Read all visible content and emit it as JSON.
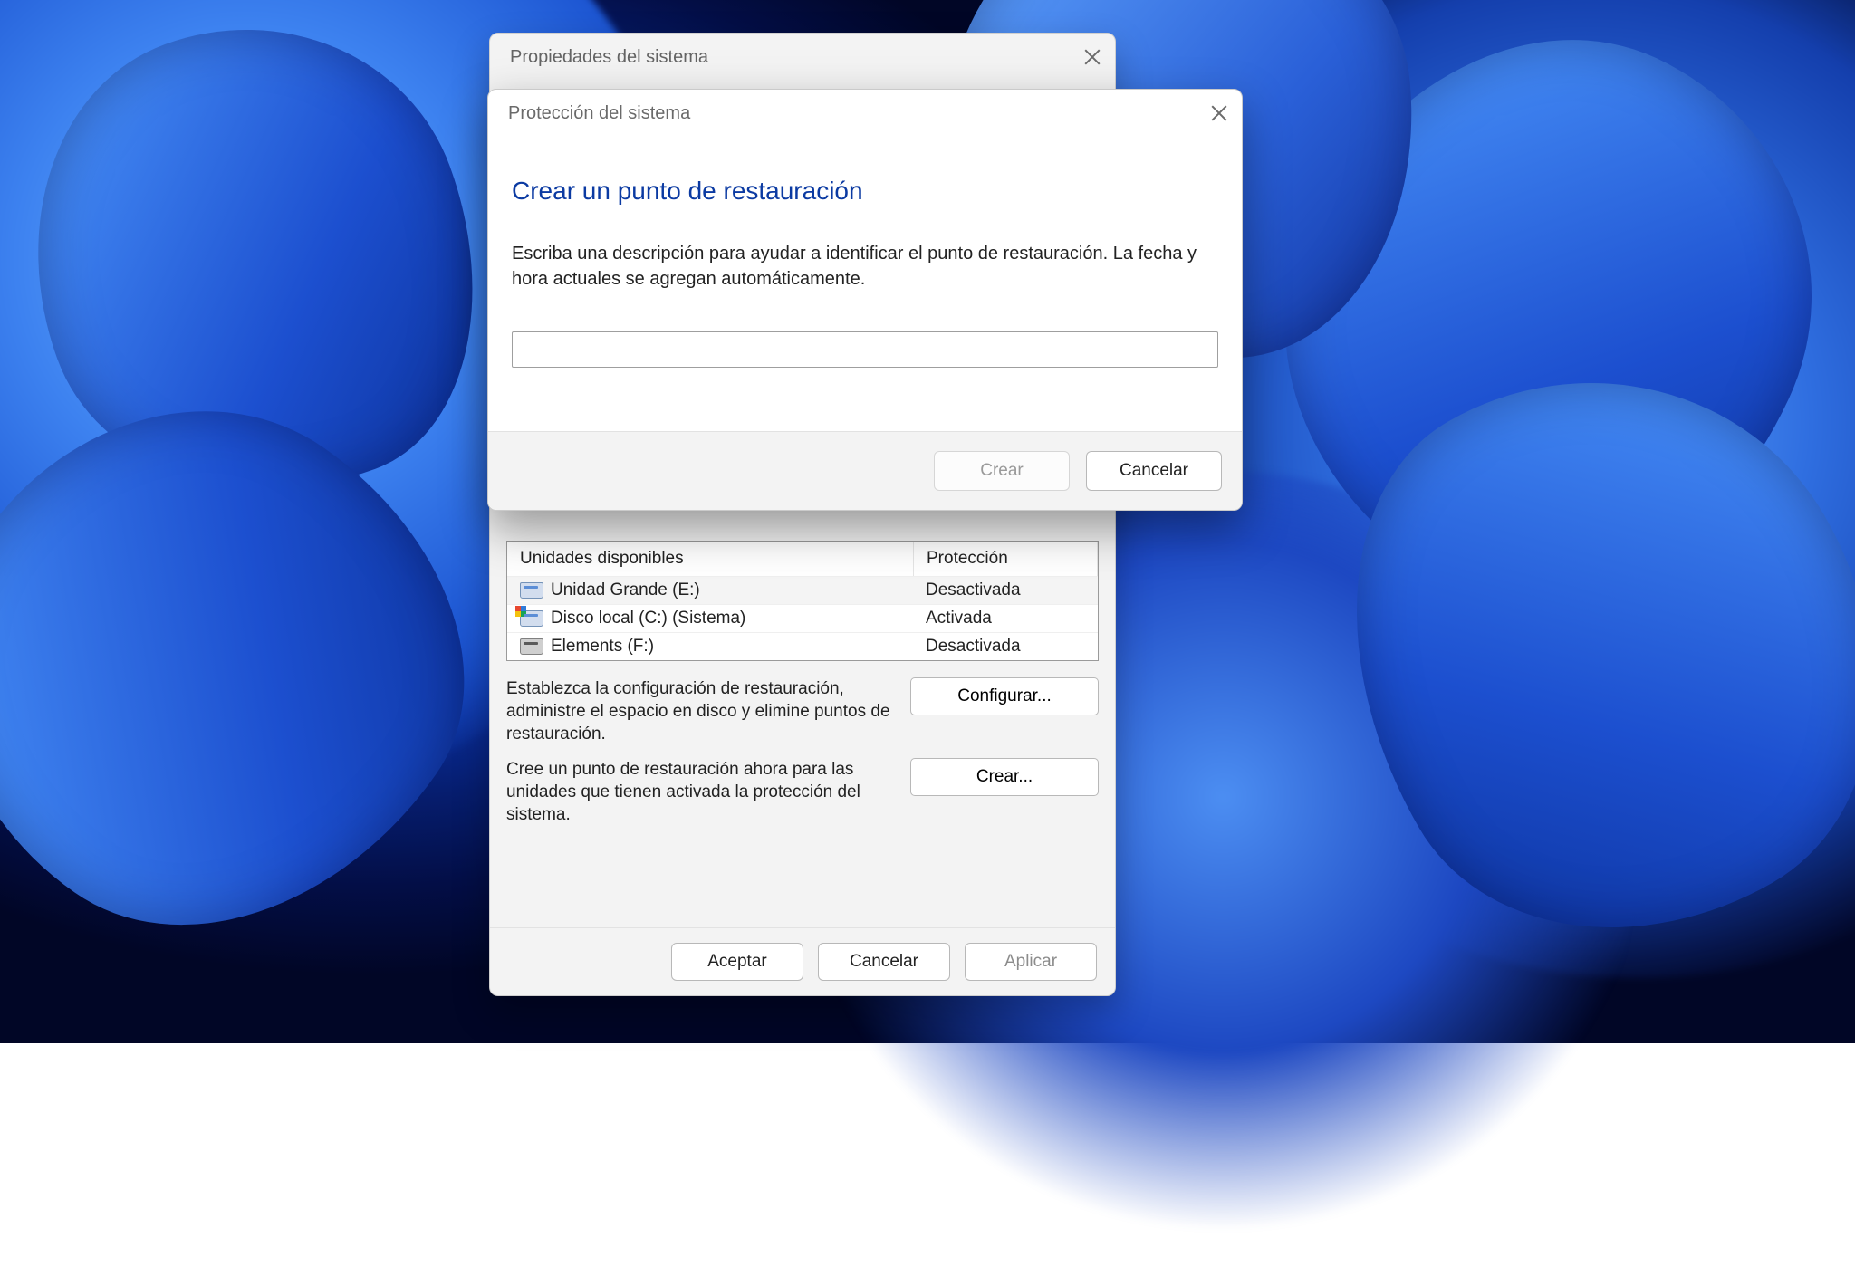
{
  "parent": {
    "title": "Propiedades del sistema",
    "table": {
      "col1": "Unidades disponibles",
      "col2": "Protección",
      "rows": [
        {
          "name": "Unidad Grande (E:)",
          "prot": "Desactivada",
          "icon": "drive",
          "selected": true
        },
        {
          "name": "Disco local (C:) (Sistema)",
          "prot": "Activada",
          "icon": "win",
          "selected": false
        },
        {
          "name": "Elements (F:)",
          "prot": "Desactivada",
          "icon": "dark",
          "selected": false
        }
      ]
    },
    "cfg_text": "Establezca la configuración de restauración, administre el espacio en disco y elimine puntos de restauración.",
    "create_text": "Cree un punto de restauración ahora para las unidades que tienen activada la protección del sistema.",
    "btn_configure": "Configurar...",
    "btn_create": "Crear...",
    "btn_ok": "Aceptar",
    "btn_cancel": "Cancelar",
    "btn_apply": "Aplicar"
  },
  "child": {
    "title": "Protección del sistema",
    "heading": "Crear un punto de restauración",
    "desc": "Escriba una descripción para ayudar a identificar el punto de restauración. La fecha y hora actuales se agregan automáticamente.",
    "input_value": "",
    "btn_create": "Crear",
    "btn_cancel": "Cancelar"
  }
}
